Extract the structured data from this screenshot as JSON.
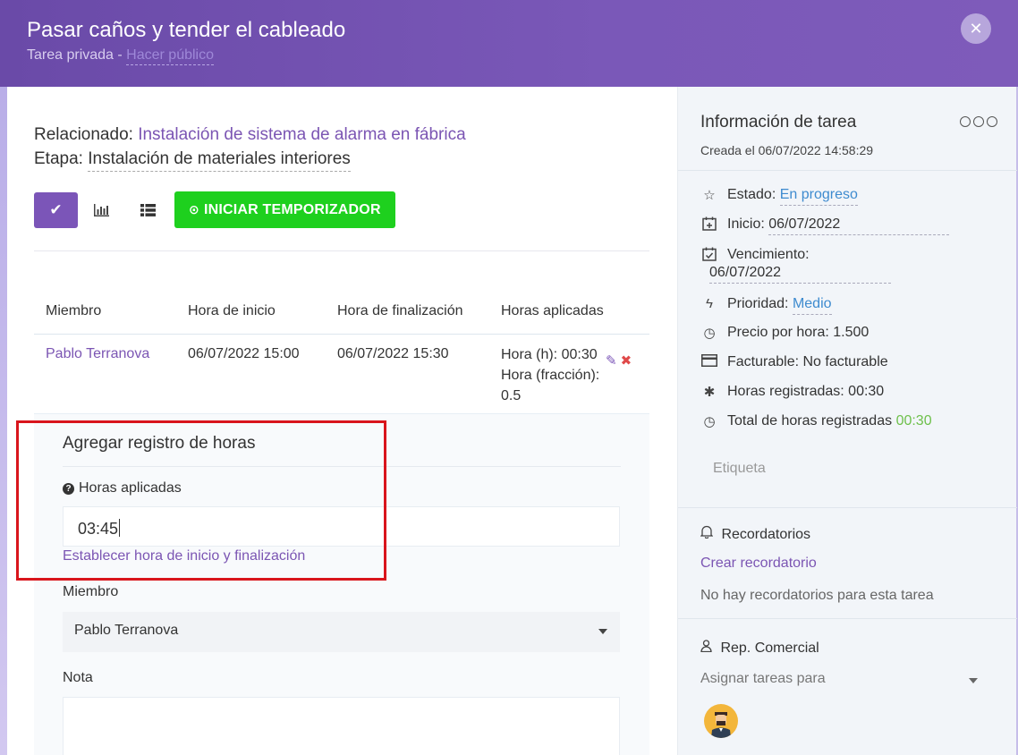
{
  "header": {
    "title": "Pasar caños y tender el cableado",
    "subtitle_prefix": "Tarea privada - ",
    "make_public": "Hacer público"
  },
  "left": {
    "related_label": "Relacionado: ",
    "related_value": "Instalación de sistema de alarma en fábrica",
    "stage_label": "Etapa: ",
    "stage_value": "Instalación de materiales interiores",
    "start_timer": "INICIAR TEMPORIZADOR",
    "table": {
      "headers": [
        "Miembro",
        "Hora de inicio",
        "Hora de finalización",
        "Horas aplicadas"
      ],
      "rows": [
        {
          "member": "Pablo Terranova",
          "start": "06/07/2022 15:00",
          "end": "06/07/2022 15:30",
          "hours_h": "Hora (h): 00:30",
          "hours_fraction": "Hora (fracción):",
          "hours_fraction_value": "0.5"
        }
      ]
    },
    "form": {
      "title": "Agregar registro de horas",
      "hours_label": "Horas aplicadas",
      "hours_value": "03:45",
      "set_times_link": "Establecer hora de inicio y finalización",
      "member_label": "Miembro",
      "member_value": "Pablo Terranova",
      "note_label": "Nota"
    }
  },
  "right": {
    "title": "Información de tarea",
    "created": "Creada el 06/07/2022 14:58:29",
    "status_label": "Estado: ",
    "status_value": "En progreso",
    "start_label": "Inicio: ",
    "start_value": "06/07/2022",
    "due_label": "Vencimiento:",
    "due_value": "06/07/2022",
    "priority_label": "Prioridad: ",
    "priority_value": "Medio",
    "hourly_price": "Precio por hora: 1.500",
    "billable": "Facturable: No facturable",
    "logged_hours": "Horas registradas: 00:30",
    "total_logged_label": "Total de horas registradas ",
    "total_logged_value": "00:30",
    "tag_placeholder": "Etiqueta",
    "reminders_title": "Recordatorios",
    "create_reminder": "Crear recordatorio",
    "no_reminders": "No hay recordatorios para esta tarea",
    "sales_rep_title": "Rep. Comercial",
    "assign_placeholder": "Asignar tareas para"
  },
  "colors": {
    "header": "#6a4aa8",
    "accent": "#7b55b3",
    "timer_button": "#1ed01e",
    "link_blue": "#3e8bcf",
    "green_value": "#6ec04b",
    "highlight": "#d9151c"
  }
}
